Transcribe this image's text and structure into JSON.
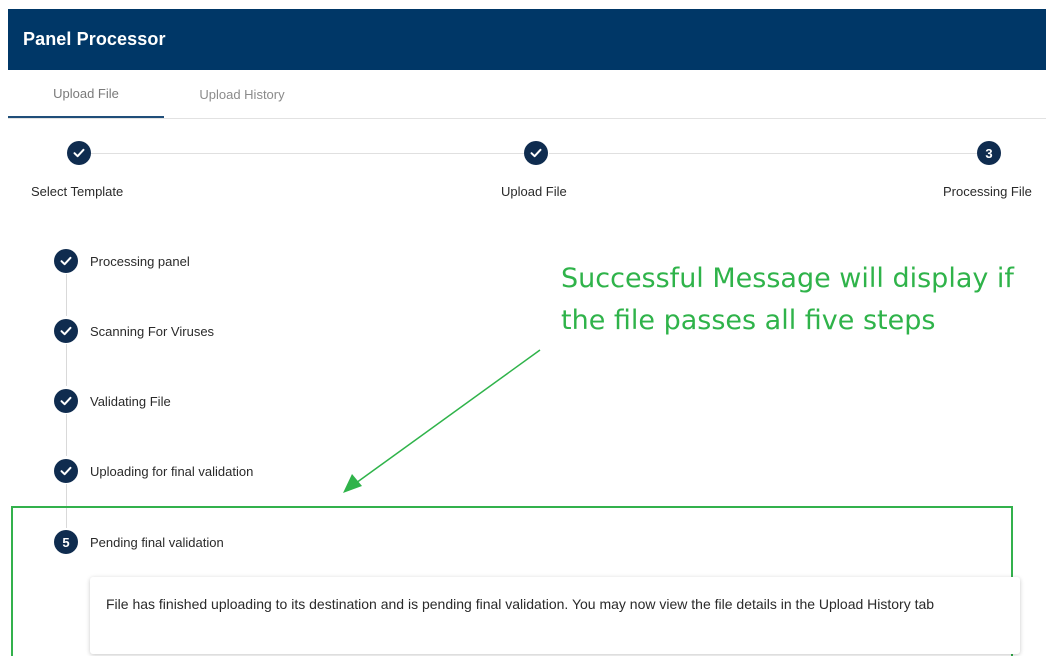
{
  "app": {
    "title": "Panel Processor"
  },
  "tabs": [
    {
      "label": "Upload File",
      "active": true
    },
    {
      "label": "Upload History",
      "active": false
    }
  ],
  "stepper": {
    "steps": [
      {
        "label": "Select Template",
        "state": "completed",
        "icon": "check-icon"
      },
      {
        "label": "Upload File",
        "state": "completed",
        "icon": "check-icon"
      },
      {
        "label": "Processing File",
        "state": "active",
        "number": "3"
      }
    ]
  },
  "processing": {
    "steps": [
      {
        "label": "Processing panel",
        "state": "completed",
        "icon": "check-icon"
      },
      {
        "label": "Scanning For Viruses",
        "state": "completed",
        "icon": "check-icon"
      },
      {
        "label": "Validating File",
        "state": "completed",
        "icon": "check-icon"
      },
      {
        "label": "Uploading for final validation",
        "state": "completed",
        "icon": "check-icon"
      },
      {
        "label": "Pending final validation",
        "state": "active",
        "number": "5"
      }
    ],
    "message": "File has finished uploading to its destination and is pending final validation. You may now view the file details in the Upload History tab"
  },
  "annotation": {
    "text": "Successful Message will display if the file passes all five steps",
    "color": "#2fb34a"
  },
  "colors": {
    "header_bg": "#003767",
    "step_circle": "#0f2c4f",
    "tab_indicator": "#1f4e79",
    "annotation": "#2fb34a"
  }
}
